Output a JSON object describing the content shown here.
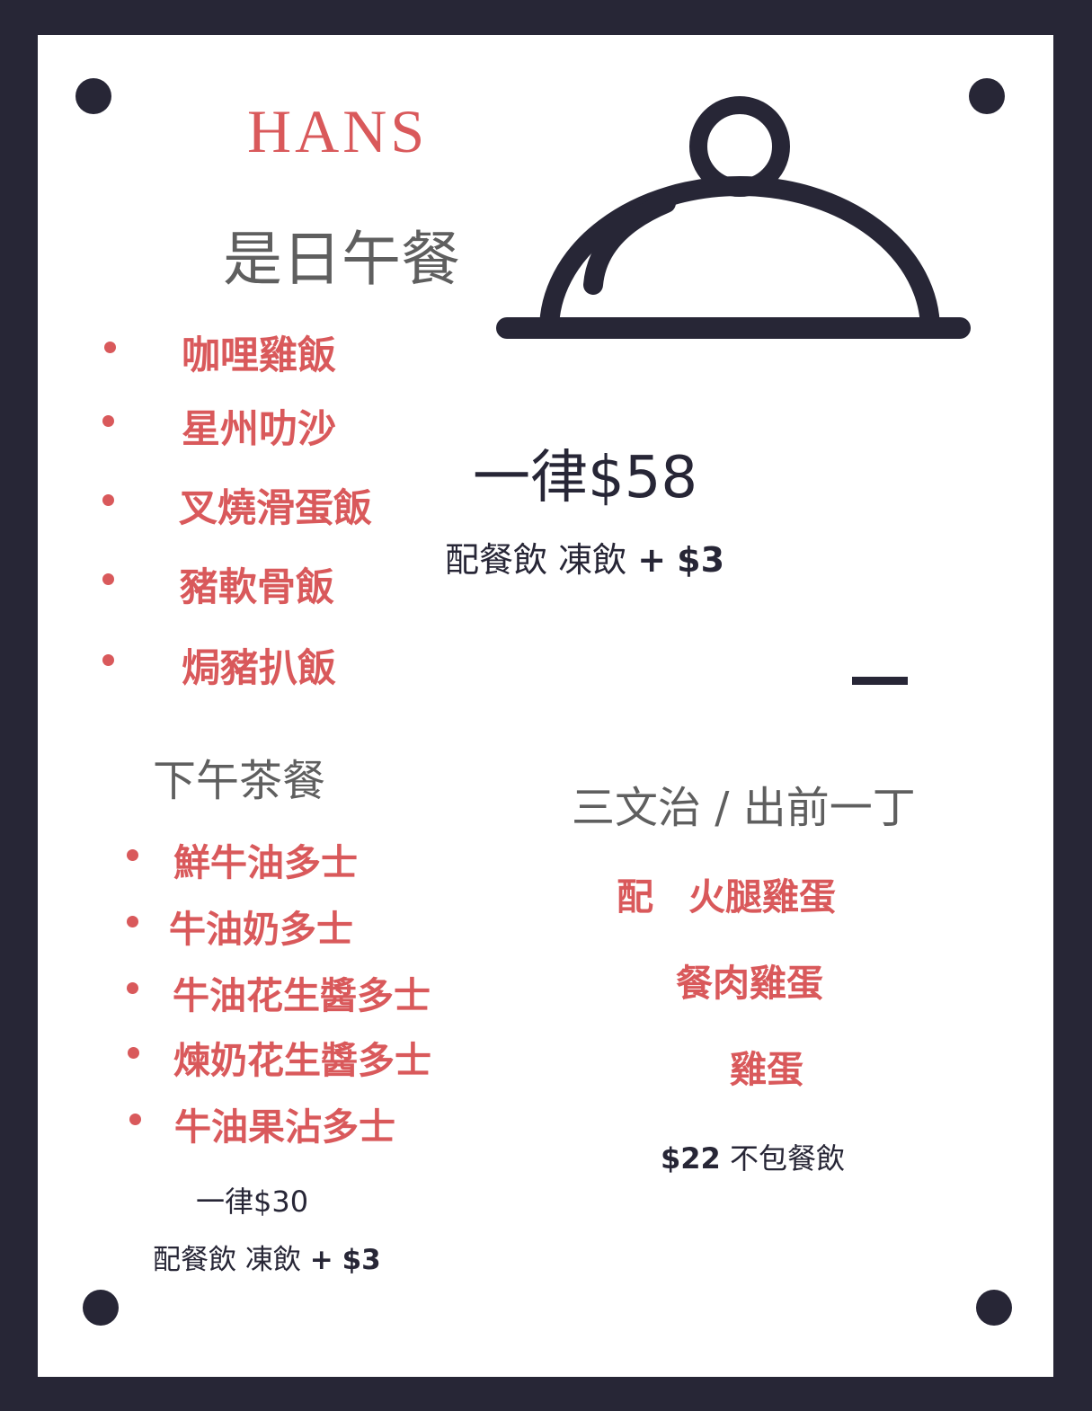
{
  "brand": "HANS",
  "colors": {
    "accent": "#d9595b",
    "dark": "#272636",
    "heading": "#5f5f5f",
    "card": "#ffffff"
  },
  "lunch": {
    "title": "是日午餐",
    "items": [
      "咖哩雞飯",
      "星州叻沙",
      "叉燒滑蛋飯",
      "豬軟骨飯",
      "焗豬扒飯"
    ],
    "price": "一律$58",
    "drink_note": "配餐飲 凍飲",
    "drink_plus": "+",
    "drink_extra": "$3"
  },
  "cloche_icon": "serving-cloche-icon",
  "tea": {
    "title": "下午茶餐",
    "items": [
      "鮮牛油多士",
      "牛油奶多士",
      "牛油花生醬多士",
      "煉奶花生醬多士",
      "牛油果沾多士"
    ],
    "price": "一律$30",
    "drink_note": "配餐飲 凍飲",
    "drink_plus": "+",
    "drink_extra": "$3"
  },
  "sandwich": {
    "title": "三文治 / 出前一丁",
    "with_label": "配",
    "options": [
      "火腿雞蛋",
      "餐肉雞蛋",
      "雞蛋"
    ],
    "price": "$22",
    "price_note": "不包餐飲"
  }
}
